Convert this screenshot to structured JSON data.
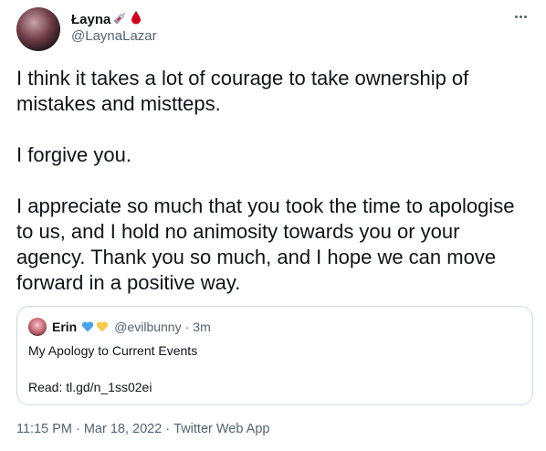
{
  "author": {
    "display_name": "Łayna",
    "handle": "@LaynaLazar",
    "badge_icons": [
      "syringe-icon",
      "blood-drop-icon"
    ]
  },
  "tweet": {
    "paragraphs": [
      "I think it takes a lot of courage to take ownership of mistakes and mistteps.",
      "I forgive you.",
      "I appreciate so much that you took the time to apologise to us, and I hold no animosity towards you or your agency. Thank you so much, and I hope we can move forward in a positive way."
    ]
  },
  "quote": {
    "name": "Erin",
    "name_icons": [
      "blue-heart-icon",
      "yellow-heart-icon"
    ],
    "handle": "@evilbunny",
    "separator": "·",
    "time": "3m",
    "line1": "My Apology to Current Events",
    "line2": "Read: tl.gd/n_1ss02ei"
  },
  "meta": {
    "time": "11:15 PM",
    "sep1": "·",
    "date": "Mar 18, 2022",
    "sep2": "·",
    "source": "Twitter Web App"
  },
  "colors": {
    "text": "#0f1419",
    "secondary": "#536471",
    "border": "#cfd9de",
    "blood": "#d0021b",
    "blue_heart": "#4aa3f0",
    "yellow_heart": "#f7c948"
  }
}
